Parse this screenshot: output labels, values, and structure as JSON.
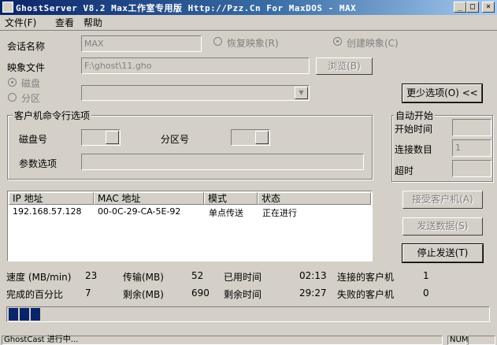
{
  "window": {
    "title": "GhostServer V8.2  Max工作室专用版 Http://Pzz.Cn   For MaxDOS - MAX",
    "minimize": "_",
    "maximize": "□",
    "close": "×"
  },
  "menu": {
    "file": "文件(F)",
    "view": "查看",
    "help": "帮助"
  },
  "session": {
    "label": "会话名称",
    "value": "MAX",
    "restore_label": "恢复映象(R)",
    "create_label": "创建映象(C)"
  },
  "image_file": {
    "label": "映象文件",
    "value": "F:\\ghost\\11.gho",
    "browse_label": "浏览(B)"
  },
  "source": {
    "disk_label": "磁盘",
    "partition_label": "分区"
  },
  "fewer_options_label": "更少选项(O) <<",
  "client_options": {
    "title": "客户机命令行选项",
    "disk_no_label": "磁盘号",
    "partition_no_label": "分区号",
    "params_label": "参数选项"
  },
  "auto_start": {
    "title": "自动开始",
    "start_time_label": "开始时间",
    "connect_count_label": "连接数目",
    "connect_count_value": "1",
    "timeout_label": "超时"
  },
  "client_list": {
    "columns": [
      "IP 地址",
      "MAC 地址",
      "模式",
      "状态"
    ],
    "rows": [
      [
        "192.168.57.128",
        "00-0C-29-CA-5E-92",
        "单点传送",
        "正在进行"
      ]
    ]
  },
  "actions": {
    "accept_clients": "接受客户机(A)",
    "send_data": "发送数据(S)",
    "stop_sending": "停止发送(T)"
  },
  "stats": {
    "speed_label": "速度 (MB/min)",
    "speed_value": "23",
    "transferred_label": "传输(MB)",
    "transferred_value": "52",
    "elapsed_label": "已用时间",
    "elapsed_value": "02:13",
    "connected_clients_label": "连接的客户机",
    "connected_clients_value": "1",
    "percent_label": "完成的百分比",
    "percent_value": "7",
    "remaining_label": "剩余(MB)",
    "remaining_value": "690",
    "remaining_time_label": "剩余时间",
    "remaining_time_value": "29:27",
    "failed_clients_label": "失败的客户机",
    "failed_clients_value": "0"
  },
  "progress": {
    "fraction": 0.07
  },
  "statusbar": {
    "text": "GhostCast 进行中...",
    "num": "NUM"
  },
  "colors": {
    "title_active": "#0a246a",
    "face": "#d4d0c8",
    "progress": "#0a246a"
  }
}
